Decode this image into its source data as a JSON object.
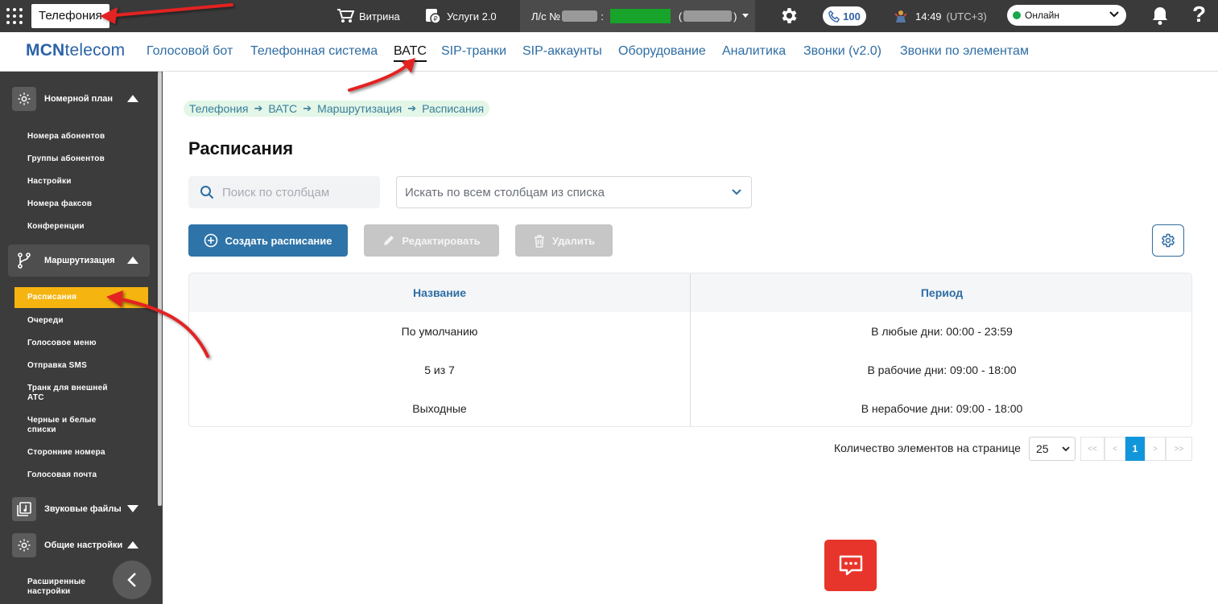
{
  "topbar": {
    "app_title": "Телефония",
    "showcase": "Витрина",
    "services": "Услуги 2.0",
    "account_prefix": "Л/с №",
    "account_colon": ":",
    "paren_open": "(",
    "paren_close": ")",
    "calls_count": "100",
    "time": "14:49",
    "timezone": "(UTC+3)",
    "status": "Онлайн",
    "help": "?"
  },
  "nav": {
    "logo_bold": "MCN",
    "logo_rest": "telecom",
    "tabs": [
      {
        "label": "Голосовой бот"
      },
      {
        "label": "Телефонная система"
      },
      {
        "label": "ВАТС"
      },
      {
        "label": "SIP-транки"
      },
      {
        "label": "SIP-аккаунты"
      },
      {
        "label": "Оборудование"
      },
      {
        "label": "Аналитика"
      },
      {
        "label": "Звонки (v2.0)"
      },
      {
        "label": "Звонки по элементам"
      }
    ]
  },
  "sidebar": {
    "groups": [
      {
        "label": "Номерной план"
      },
      {
        "label": "Маршрутизация"
      },
      {
        "label": "Звуковые файлы"
      },
      {
        "label": "Общие настройки"
      }
    ],
    "numbering_items": [
      {
        "label": "Номера абонентов"
      },
      {
        "label": "Группы абонентов"
      },
      {
        "label": "Настройки"
      },
      {
        "label": "Номера факсов"
      },
      {
        "label": "Конференции"
      }
    ],
    "routing_items": [
      {
        "label": "Расписания"
      },
      {
        "label": "Очереди"
      },
      {
        "label": "Голосовое меню"
      },
      {
        "label": "Отправка SMS"
      },
      {
        "label": "Транк для внешней АТС"
      },
      {
        "label": "Черные и белые списки"
      },
      {
        "label": "Сторонние номера"
      },
      {
        "label": "Голосовая почта"
      }
    ],
    "general_items": [
      {
        "label": "Расширенные настройки"
      }
    ]
  },
  "breadcrumb": [
    "Телефония",
    "ВАТС",
    "Маршрутизация",
    "Расписания"
  ],
  "breadcrumb_sep": "➔",
  "page": {
    "title": "Расписания",
    "search_placeholder": "Поиск по столбцам",
    "columns_select": "Искать по всем столбцам из списка",
    "create_button": "Создать расписание",
    "edit_button": "Редактировать",
    "delete_button": "Удалить"
  },
  "table": {
    "columns": [
      "Название",
      "Период"
    ],
    "rows": [
      {
        "name": "По умолчанию",
        "period": "В любые дни: 00:00 - 23:59"
      },
      {
        "name": "5 из 7",
        "period": "В рабочие дни: 09:00 - 18:00"
      },
      {
        "name": "Выходные",
        "period": "В нерабочие дни: 09:00 - 18:00"
      }
    ]
  },
  "pagination": {
    "per_page_label": "Количество элементов на странице",
    "per_page_value": "25",
    "first": "<<",
    "prev": "<",
    "current": "1",
    "next": ">",
    "last": ">>"
  },
  "colors": {
    "topbar_bg": "#3a3a3a",
    "sidebar_bg": "#3c3c3c",
    "accent_blue": "#2f74a8",
    "active_menu": "#f5b40f",
    "chat_red": "#e8352b",
    "annotation_red": "#e32222"
  },
  "icons": [
    "apps-grid-icon",
    "cart-icon",
    "services-icon",
    "gear-icon",
    "phone-icon",
    "avatar-icon",
    "chevron-down-icon",
    "bell-icon",
    "help-icon",
    "settings-gear-icon",
    "routing-icon",
    "music-file-icon",
    "search-icon",
    "plus-circle-icon",
    "pencil-icon",
    "trash-icon",
    "chat-icon",
    "chevron-left-icon"
  ]
}
